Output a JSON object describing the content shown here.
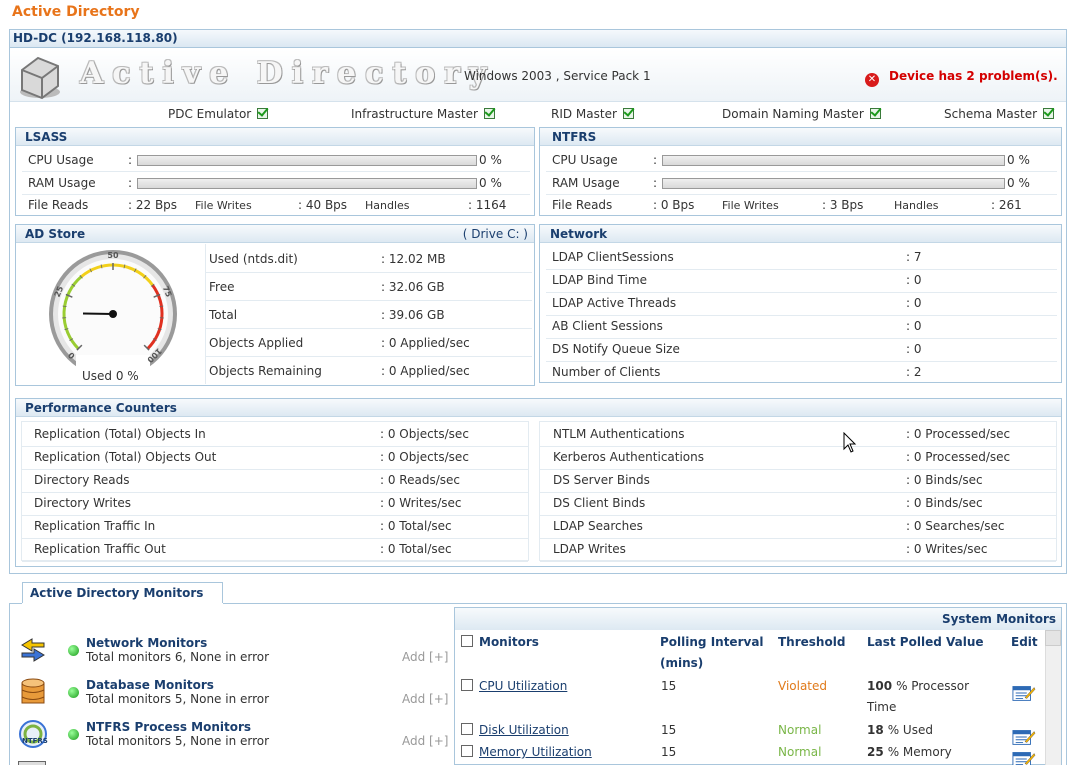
{
  "page_title": "Active Directory",
  "device": {
    "name": "HD-DC (192.168.118.80)",
    "banner_title": "Active Directory",
    "os": "Windows 2003 , Service Pack 1",
    "problem": "Device has 2 problem(s)."
  },
  "roles": [
    "PDC Emulator",
    "Infrastructure Master",
    "RID Master",
    "Domain Naming Master",
    "Schema Master"
  ],
  "lsass": {
    "title": "LSASS",
    "cpu_label": "CPU Usage",
    "cpu_value": "0 %",
    "cpu_fraction": 0,
    "ram_label": "RAM Usage",
    "ram_value": "0 %",
    "ram_fraction": 0,
    "reads_label": "File Reads",
    "reads_value": "22 Bps",
    "writes_label": "File Writes",
    "writes_value": "40 Bps",
    "handles_label": "Handles",
    "handles_value": "1164"
  },
  "ntfrs": {
    "title": "NTFRS",
    "cpu_label": "CPU Usage",
    "cpu_value": "0 %",
    "cpu_fraction": 0,
    "ram_label": "RAM Usage",
    "ram_value": "0 %",
    "ram_fraction": 0,
    "reads_label": "File Reads",
    "reads_value": "0 Bps",
    "writes_label": "File Writes",
    "writes_value": "3 Bps",
    "handles_label": "Handles",
    "handles_value": "261"
  },
  "ad_store": {
    "title": "AD Store",
    "drive": "( Drive C: )",
    "gauge_caption": "Used 0 %",
    "gauge_value": 0,
    "gauge_ticks": [
      "0",
      "25",
      "50",
      "75",
      "100"
    ],
    "rows": [
      {
        "label": "Used (ntds.dit)",
        "value": ": 12.02 MB"
      },
      {
        "label": "Free",
        "value": ": 32.06 GB"
      },
      {
        "label": "Total",
        "value": ": 39.06 GB"
      },
      {
        "label": "Objects Applied",
        "value": ": 0 Applied/sec"
      },
      {
        "label": "Objects Remaining",
        "value": ": 0 Applied/sec"
      }
    ]
  },
  "network": {
    "title": "Network",
    "rows": [
      {
        "label": "LDAP ClientSessions",
        "value": ": 7"
      },
      {
        "label": "LDAP Bind Time",
        "value": ": 0"
      },
      {
        "label": "LDAP Active Threads",
        "value": ": 0"
      },
      {
        "label": "AB Client Sessions",
        "value": ": 0"
      },
      {
        "label": "DS Notify Queue Size",
        "value": ": 0"
      },
      {
        "label": "Number of Clients",
        "value": ": 2"
      }
    ]
  },
  "perf": {
    "title": "Performance Counters",
    "left": [
      {
        "label": "Replication (Total) Objects In",
        "value": ": 0 Objects/sec"
      },
      {
        "label": "Replication (Total) Objects Out",
        "value": ": 0 Objects/sec"
      },
      {
        "label": "Directory Reads",
        "value": ": 0 Reads/sec"
      },
      {
        "label": "Directory Writes",
        "value": ": 0 Writes/sec"
      },
      {
        "label": "Replication Traffic In",
        "value": ": 0 Total/sec"
      },
      {
        "label": "Replication Traffic Out",
        "value": ": 0 Total/sec"
      }
    ],
    "right": [
      {
        "label": "NTLM Authentications",
        "value": ": 0 Processed/sec"
      },
      {
        "label": "Kerberos Authentications",
        "value": ": 0 Processed/sec"
      },
      {
        "label": "DS Server Binds",
        "value": ": 0 Binds/sec"
      },
      {
        "label": "DS Client Binds",
        "value": ": 0 Binds/sec"
      },
      {
        "label": "LDAP Searches",
        "value": ": 0 Searches/sec"
      },
      {
        "label": "LDAP Writes",
        "value": ": 0 Writes/sec"
      }
    ]
  },
  "monitors_tab": "Active Directory Monitors",
  "monitor_groups": [
    {
      "title": "Network Monitors",
      "sub": "Total monitors 6, None in error",
      "add": "Add [+]"
    },
    {
      "title": "Database Monitors",
      "sub": "Total monitors 5, None in error",
      "add": "Add [+]"
    },
    {
      "title": "NTFRS Process Monitors",
      "sub": "Total monitors 5, None in error",
      "add": "Add [+]"
    }
  ],
  "system_monitors": {
    "title": "System Monitors",
    "headers": {
      "monitors": "Monitors",
      "polling": "Polling Interval",
      "polling2": "(mins)",
      "threshold": "Threshold",
      "last": "Last Polled Value",
      "edit": "Edit"
    },
    "rows": [
      {
        "name": "CPU Utilization",
        "interval": "15",
        "threshold": "Violated",
        "value": "100",
        "unit": "% Processor",
        "unit2": "Time"
      },
      {
        "name": "Disk Utilization",
        "interval": "15",
        "threshold": "Normal",
        "value": "18",
        "unit": "% Used",
        "unit2": ""
      },
      {
        "name": "Memory Utilization",
        "interval": "15",
        "threshold": "Normal",
        "value": "25",
        "unit": "% Memory",
        "unit2": ""
      }
    ]
  },
  "colors": {
    "accent": "#e8741a",
    "heading": "#1a3e6e",
    "violated": "#e07a1a",
    "normal": "#7ab648",
    "error": "#d40000"
  }
}
